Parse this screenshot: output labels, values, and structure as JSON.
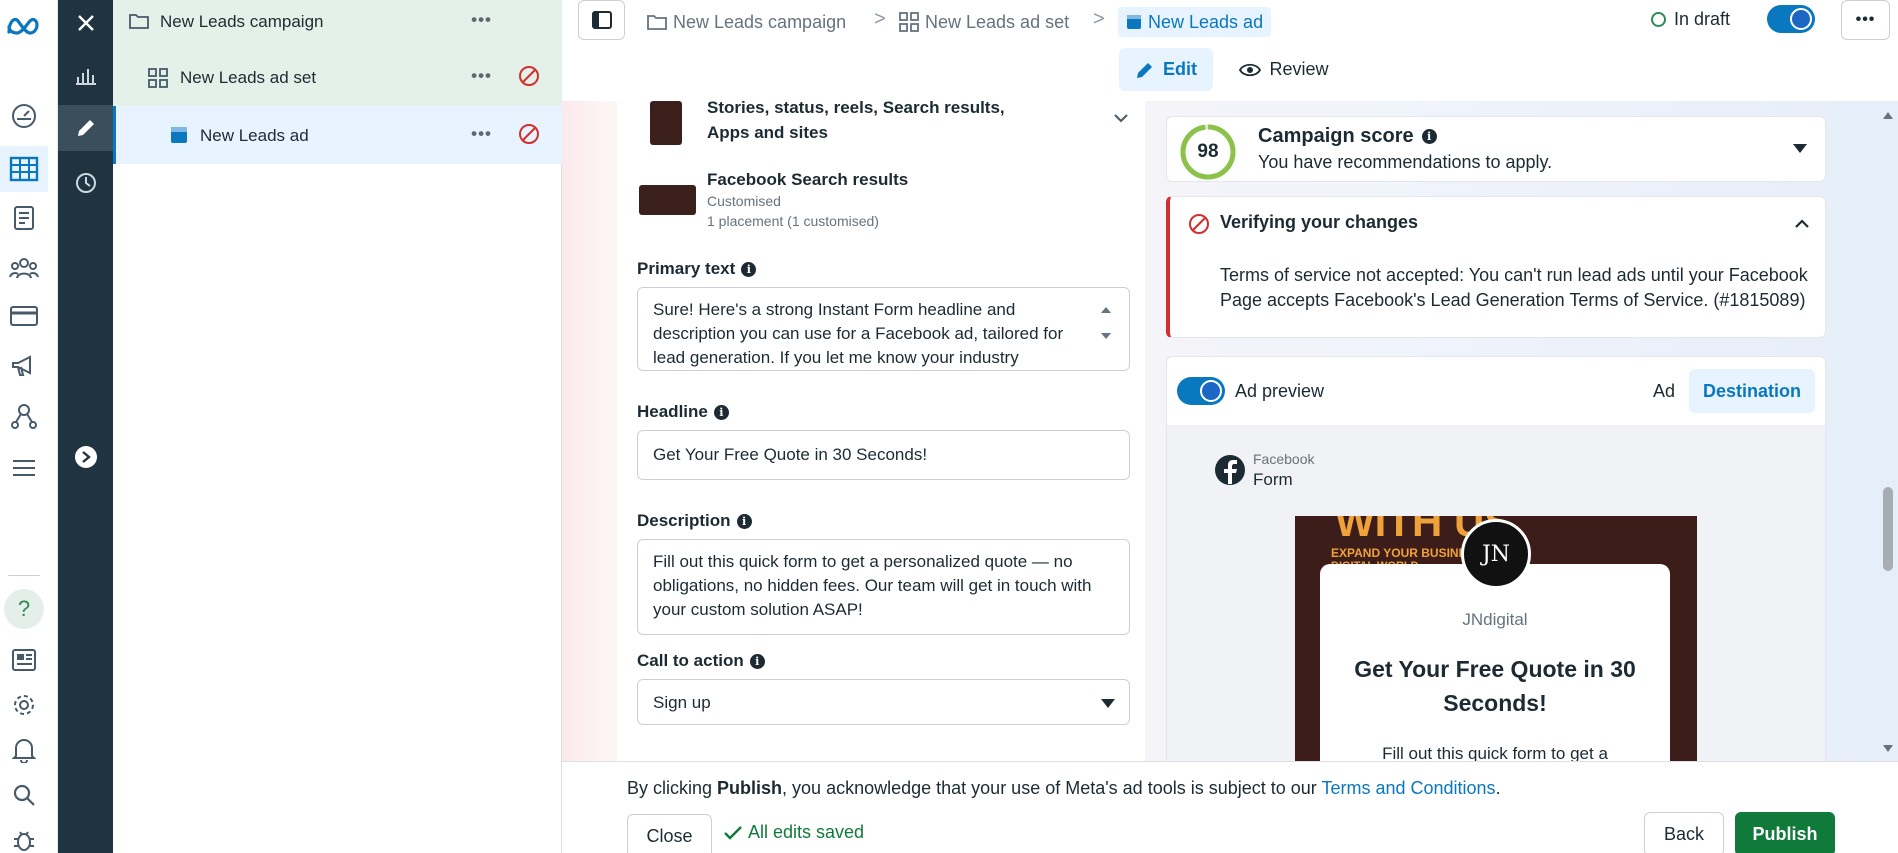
{
  "tree": {
    "campaign": "New Leads campaign",
    "adset": "New Leads ad set",
    "ad": "New Leads ad",
    "more": "•••"
  },
  "breadcrumb": {
    "campaign": "New Leads campaign",
    "adset": "New Leads ad set",
    "ad": "New Leads ad",
    "sep": ">"
  },
  "status": {
    "label": "In draft",
    "more": "•••"
  },
  "modes": {
    "edit": "Edit",
    "review": "Review"
  },
  "placements": {
    "stories_line1": "Stories, status, reels, Search results,",
    "stories_line2": "Apps and sites",
    "search_title": "Facebook Search results",
    "search_sub1": "Customised",
    "search_sub2": "1 placement (1 customised)"
  },
  "fields": {
    "primary_text_label": "Primary text",
    "primary_text_value": "Sure! Here's a strong Instant Form headline and description you can use for a Facebook ad, tailored for lead generation. If you let me know your industry",
    "headline_label": "Headline",
    "headline_value": "Get Your Free Quote in 30 Seconds!",
    "description_label": "Description",
    "description_value": "Fill out this quick form to get a personalized quote — no obligations, no hidden fees. Our team will get in touch with your custom solution ASAP!",
    "cta_label": "Call to action",
    "cta_value": "Sign up",
    "info": "i"
  },
  "score": {
    "value": "98",
    "title": "Campaign score",
    "subtitle": "You have recommendations to apply."
  },
  "verify": {
    "title": "Verifying your changes",
    "message": "Terms of service not accepted: You can't run lead ads until your Facebook Page accepts Facebook's Lead Generation Terms of Service. (#1815089)"
  },
  "preview": {
    "toggle_label": "Ad preview",
    "tab_ad": "Ad",
    "tab_destination": "Destination",
    "platform": "Facebook",
    "type": "Form",
    "banner_text": "WITH US",
    "banner_sub": "EXPAND YOUR BUSINESS",
    "banner_sub2": "DIGITAL WORLD",
    "avatar_initials": "JN",
    "page_name": "JNdigital",
    "form_headline": "Get Your Free Quote in 30 Seconds!",
    "form_desc": "Fill out this quick form to get a"
  },
  "footer": {
    "notice_pre": "By clicking ",
    "notice_bold": "Publish",
    "notice_mid": ", you acknowledge that your use of Meta's ad tools is subject to our ",
    "notice_link": "Terms and Conditions",
    "notice_end": ".",
    "close": "Close",
    "saved": "All edits saved",
    "back": "Back",
    "publish": "Publish"
  },
  "colors": {
    "accent": "#0a78be",
    "publish": "#0f7a3a",
    "error": "#d32f2f",
    "score_ring": "#8bc34a"
  }
}
